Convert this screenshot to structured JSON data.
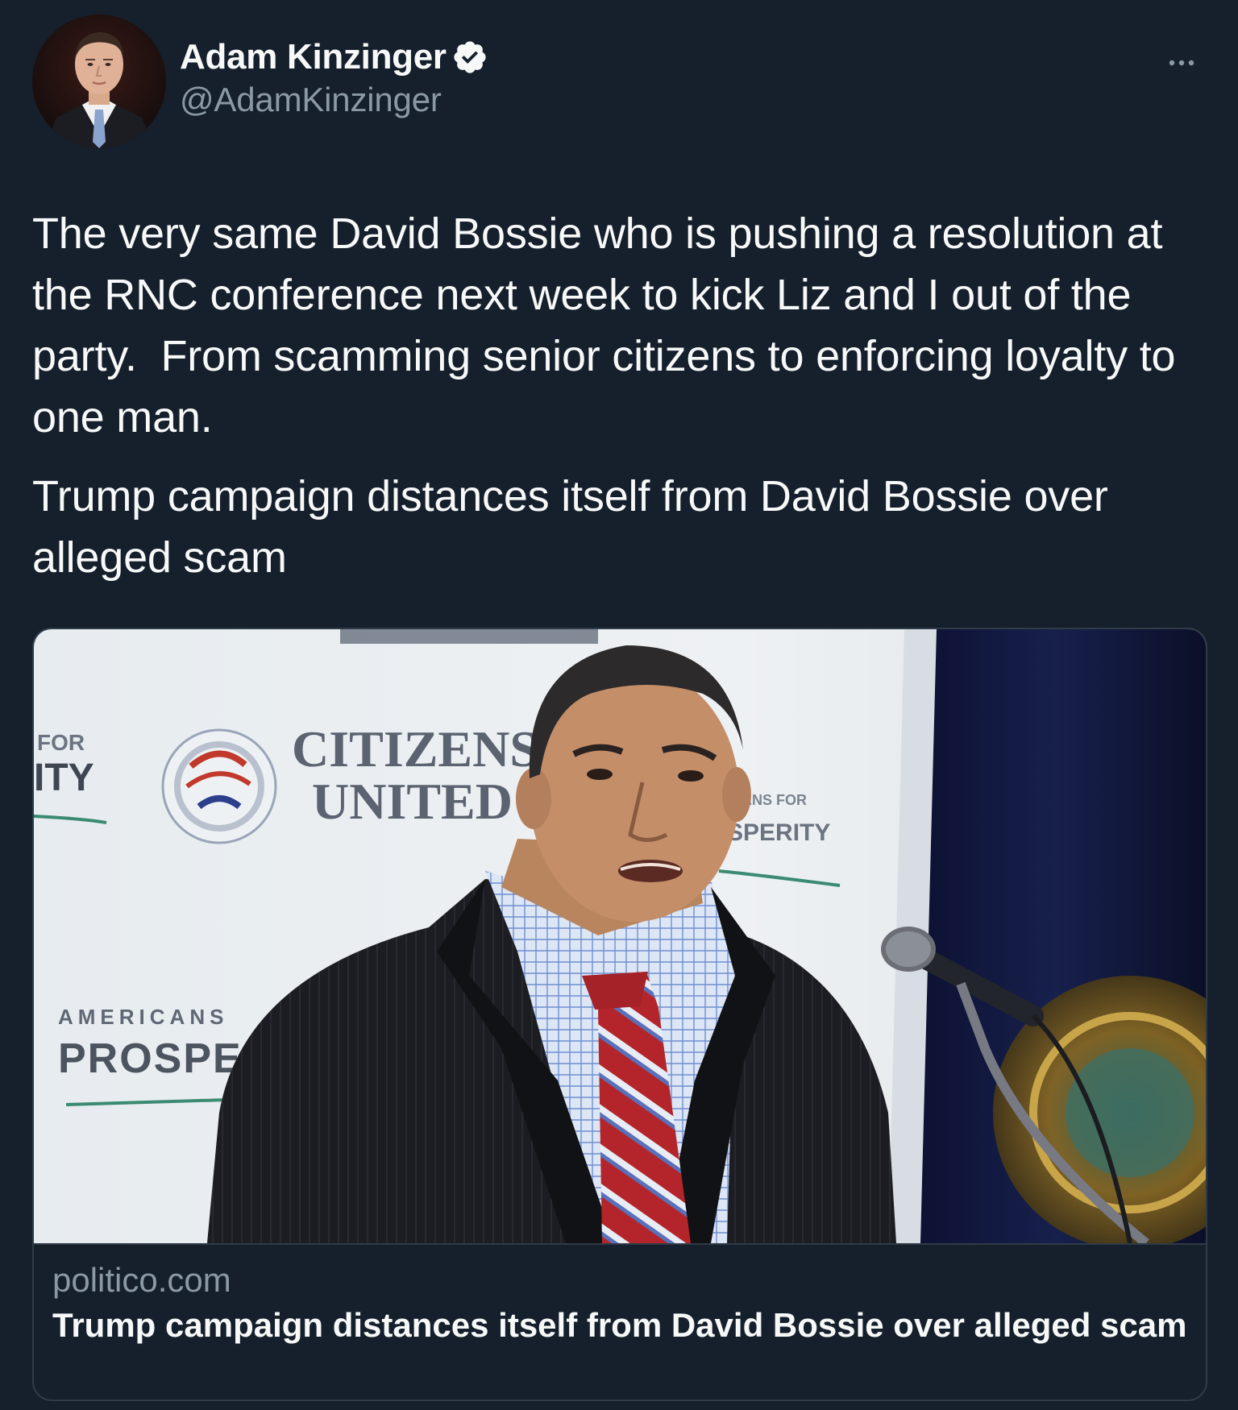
{
  "author": {
    "display_name": "Adam Kinzinger",
    "handle": "@AdamKinzinger",
    "verified": true,
    "avatar_icon": "profile-photo"
  },
  "actions": {
    "more_icon": "more-dots-icon"
  },
  "tweet": {
    "text": "The very same David Bossie who is pushing a resolution at the RNC conference next week to kick Liz and I out of the party.  From scamming senior citizens to enforcing loyalty to one man.",
    "headline": "Trump campaign distances itself from David Bossie over alleged scam"
  },
  "link_card": {
    "domain": "politico.com",
    "title": "Trump campaign distances itself from David Bossie over alleged scam",
    "image_signage": {
      "citizens_line1": "CITIZENS",
      "citizens_line2": "UNITED",
      "left_fragment_top": "FOR",
      "left_fragment_bottom": "ITY",
      "americans": "AMERICANS",
      "prosper": "PROSPER",
      "right_fragment_top": "ICANS FOR",
      "right_fragment_bottom": "SPERITY"
    }
  },
  "colors": {
    "background": "#16202c",
    "primary_text": "#f7f9f9",
    "secondary_text": "#8b98a5",
    "border": "#2f3b47",
    "verified_badge": "#f7f9f9"
  }
}
